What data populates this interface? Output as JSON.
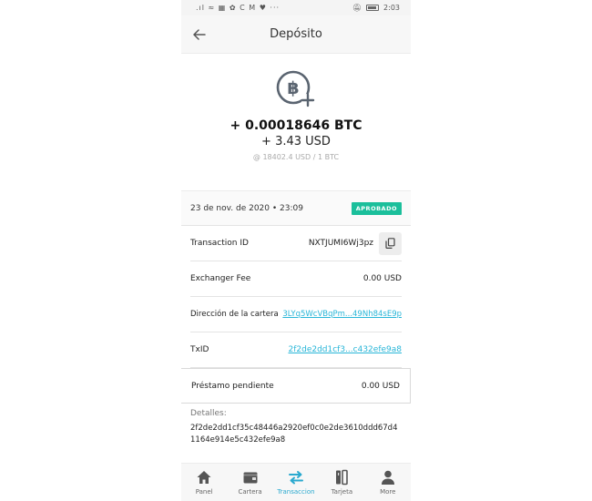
{
  "status_bar": {
    "left_icons": ".ıl ≈ ▦ ✿ C M ♥ ···",
    "right_text": "2:03"
  },
  "header": {
    "title": "Depósito"
  },
  "hero": {
    "amount_btc": "+ 0.00018646 BTC",
    "amount_usd": "+ 3.43 USD",
    "rate": "@ 18402.4 USD / 1 BTC"
  },
  "status": {
    "date": "23 de nov. de 2020 • 23:09",
    "badge": "APROBADO"
  },
  "rows": {
    "transaction_id": {
      "label": "Transaction ID",
      "value": "NXTJUMI6Wj3pz"
    },
    "exchanger_fee": {
      "label": "Exchanger Fee",
      "value": "0.00 USD"
    },
    "wallet": {
      "label": "Dirección de la cartera",
      "value": "3LYq5WcVBqPm...49Nh84sE9p"
    },
    "txid": {
      "label": "TxID",
      "value": "2f2de2dd1cf3...c432efe9a8"
    },
    "loan": {
      "label": "Préstamo pendiente",
      "value": "0.00 USD"
    }
  },
  "details": {
    "label": "Detalles:",
    "value": "2f2de2dd1cf35c48446a2920ef0c0e2de3610ddd67d41164e914e5c432efe9a8"
  },
  "nav": {
    "items": [
      {
        "label": "Panel",
        "icon": "home-icon"
      },
      {
        "label": "Cartera",
        "icon": "wallet-icon"
      },
      {
        "label": "Transaccion",
        "icon": "transfer-icon",
        "active": true
      },
      {
        "label": "Tarjeta",
        "icon": "card-icon"
      },
      {
        "label": "More",
        "icon": "person-icon"
      }
    ]
  },
  "colors": {
    "accent": "#29b6d8",
    "badge": "#1bbf9b",
    "nav_icon": "#555555",
    "nav_active": "#2aa9cf"
  }
}
